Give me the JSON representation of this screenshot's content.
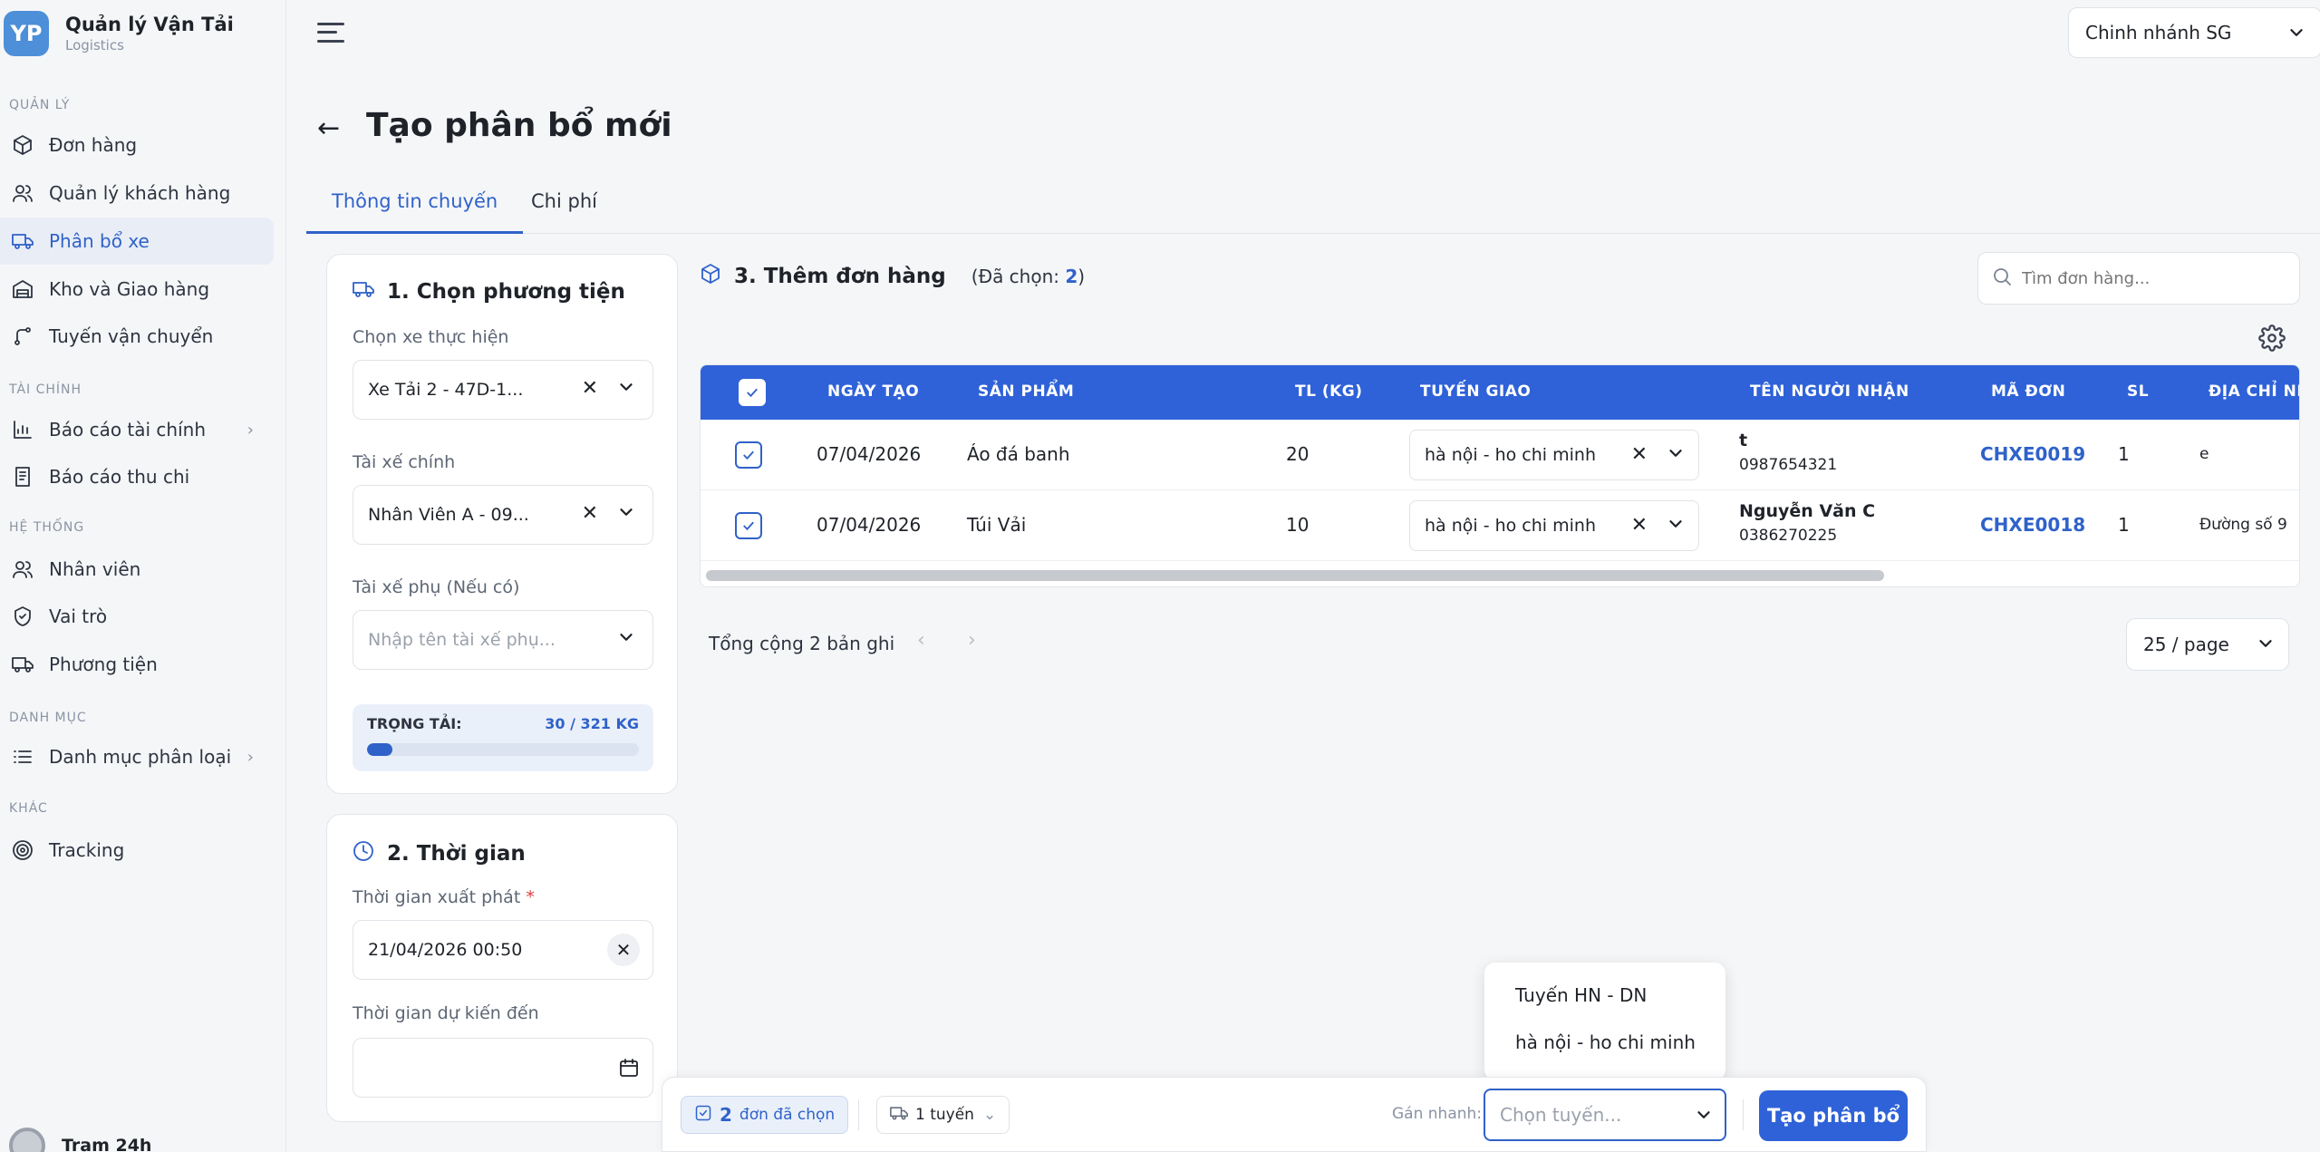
{
  "app": {
    "title": "Quản lý Vận Tải",
    "subtitle": "Logistics",
    "logo_text": "YP"
  },
  "sidebar": {
    "sections": [
      "QUẢN LÝ",
      "TÀI CHÍNH",
      "HỆ THỐNG",
      "DANH MỤC",
      "KHÁC"
    ],
    "items": [
      {
        "label": "Đơn hàng",
        "icon": "package-icon"
      },
      {
        "label": "Quản lý khách hàng",
        "icon": "users-icon"
      },
      {
        "label": "Phân bổ xe",
        "icon": "truck-icon",
        "active": true
      },
      {
        "label": "Kho và Giao hàng",
        "icon": "warehouse-icon"
      },
      {
        "label": "Tuyến vận chuyển",
        "icon": "route-icon"
      },
      {
        "label": "Báo cáo tài chính",
        "icon": "chart-icon"
      },
      {
        "label": "Báo cáo thu chi",
        "icon": "receipt-icon"
      },
      {
        "label": "Nhân viên",
        "icon": "users-icon"
      },
      {
        "label": "Vai trò",
        "icon": "shield-icon"
      },
      {
        "label": "Phương tiện",
        "icon": "truck-icon"
      },
      {
        "label": "Danh mục phân loại",
        "icon": "list-icon"
      },
      {
        "label": "Tracking",
        "icon": "target-icon"
      }
    ],
    "user": "Trạm 24h"
  },
  "header": {
    "branch": "Chinh nhánh SG"
  },
  "page": {
    "title": "Tạo phân bổ mới",
    "tabs": [
      "Thông tin chuyến",
      "Chi phí"
    ]
  },
  "vehicle": {
    "title": "1. Chọn phương tiện",
    "vehicle_label": "Chọn xe thực hiện",
    "vehicle_value": "Xe Tải 2 - 47D-1...",
    "driver_label": "Tài xế chính",
    "driver_value": "Nhân Viên A - 09...",
    "assistant_label": "Tài xế phụ (Nếu có)",
    "assistant_placeholder": "Nhập tên tài xế phụ...",
    "load_label": "TRỌNG TẢI:",
    "load_value": "30 / 321 KG",
    "load_fraction": 0.093
  },
  "time": {
    "title": "2. Thời gian",
    "depart_label": "Thời gian xuất phát",
    "required_mark": "*",
    "depart_value": "21/04/2026 00:50",
    "arrive_label": "Thời gian dự kiến đến"
  },
  "orders": {
    "title": "3. Thêm đơn hàng",
    "selected_prefix": "(Đã chọn: ",
    "selected_count": "2",
    "selected_suffix": ")",
    "search_placeholder": "Tìm đơn hàng...",
    "columns": [
      "NGÀY TẠO",
      "SẢN PHẨM",
      "TL (KG)",
      "TUYẾN GIAO",
      "TÊN NGƯỜI NHẬN",
      "MÃ ĐƠN",
      "SL",
      "ĐỊA CHỈ NH"
    ],
    "rows": [
      {
        "date": "07/04/2026",
        "product": "Áo đá banh",
        "weight": "20",
        "route": "hà nội - ho chi minh",
        "receiver": "t",
        "phone": "0987654321",
        "code": "CHXE0019",
        "qty": "1",
        "address": "e"
      },
      {
        "date": "07/04/2026",
        "product": "Túi Vải",
        "weight": "10",
        "route": "hà nội - ho chi minh",
        "receiver": "Nguyễn Văn C",
        "phone": "0386270225",
        "code": "CHXE0018",
        "qty": "1",
        "address": "Đường số 9"
      }
    ],
    "total": "Tổng cộng 2 bản ghi",
    "page_size": "25 / page"
  },
  "dropdown": {
    "items": [
      "Tuyến HN - DN",
      "hà nội - ho chi minh"
    ]
  },
  "bottom": {
    "selected_count": "2",
    "selected_label": "đơn đã chọn",
    "routes": "1 tuyến",
    "quick_label": "Gán nhanh:",
    "choose_placeholder": "Chọn tuyến...",
    "create_label": "Tạo phân bổ"
  },
  "colors": {
    "accent": "#2f62d8",
    "sidebar_active_bg": "#e8edf6"
  }
}
